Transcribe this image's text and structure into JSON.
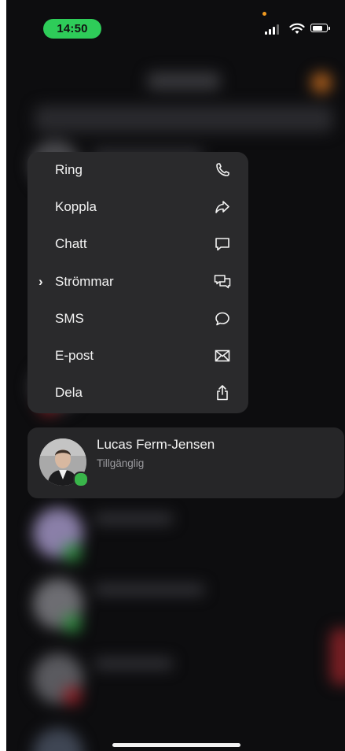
{
  "status_bar": {
    "time": "14:50"
  },
  "menu": {
    "items": [
      {
        "label": "Ring",
        "icon": "phone-icon",
        "selected": false
      },
      {
        "label": "Koppla",
        "icon": "forward-icon",
        "selected": false
      },
      {
        "label": "Chatt",
        "icon": "chat-bubble-icon",
        "selected": false
      },
      {
        "label": "Strömmar",
        "icon": "chat-bubbles-icon",
        "selected": true
      },
      {
        "label": "SMS",
        "icon": "message-circle-icon",
        "selected": false
      },
      {
        "label": "E-post",
        "icon": "mail-icon",
        "selected": false
      },
      {
        "label": "Dela",
        "icon": "share-icon",
        "selected": false
      }
    ]
  },
  "contact": {
    "name": "Lucas Ferm-Jensen",
    "status": "Tillgänglig",
    "presence_color": "#39b54a"
  },
  "colors": {
    "accent_green": "#2ecc59",
    "menu_bg": "#2a2a2c",
    "background": "#0d0d0f"
  }
}
